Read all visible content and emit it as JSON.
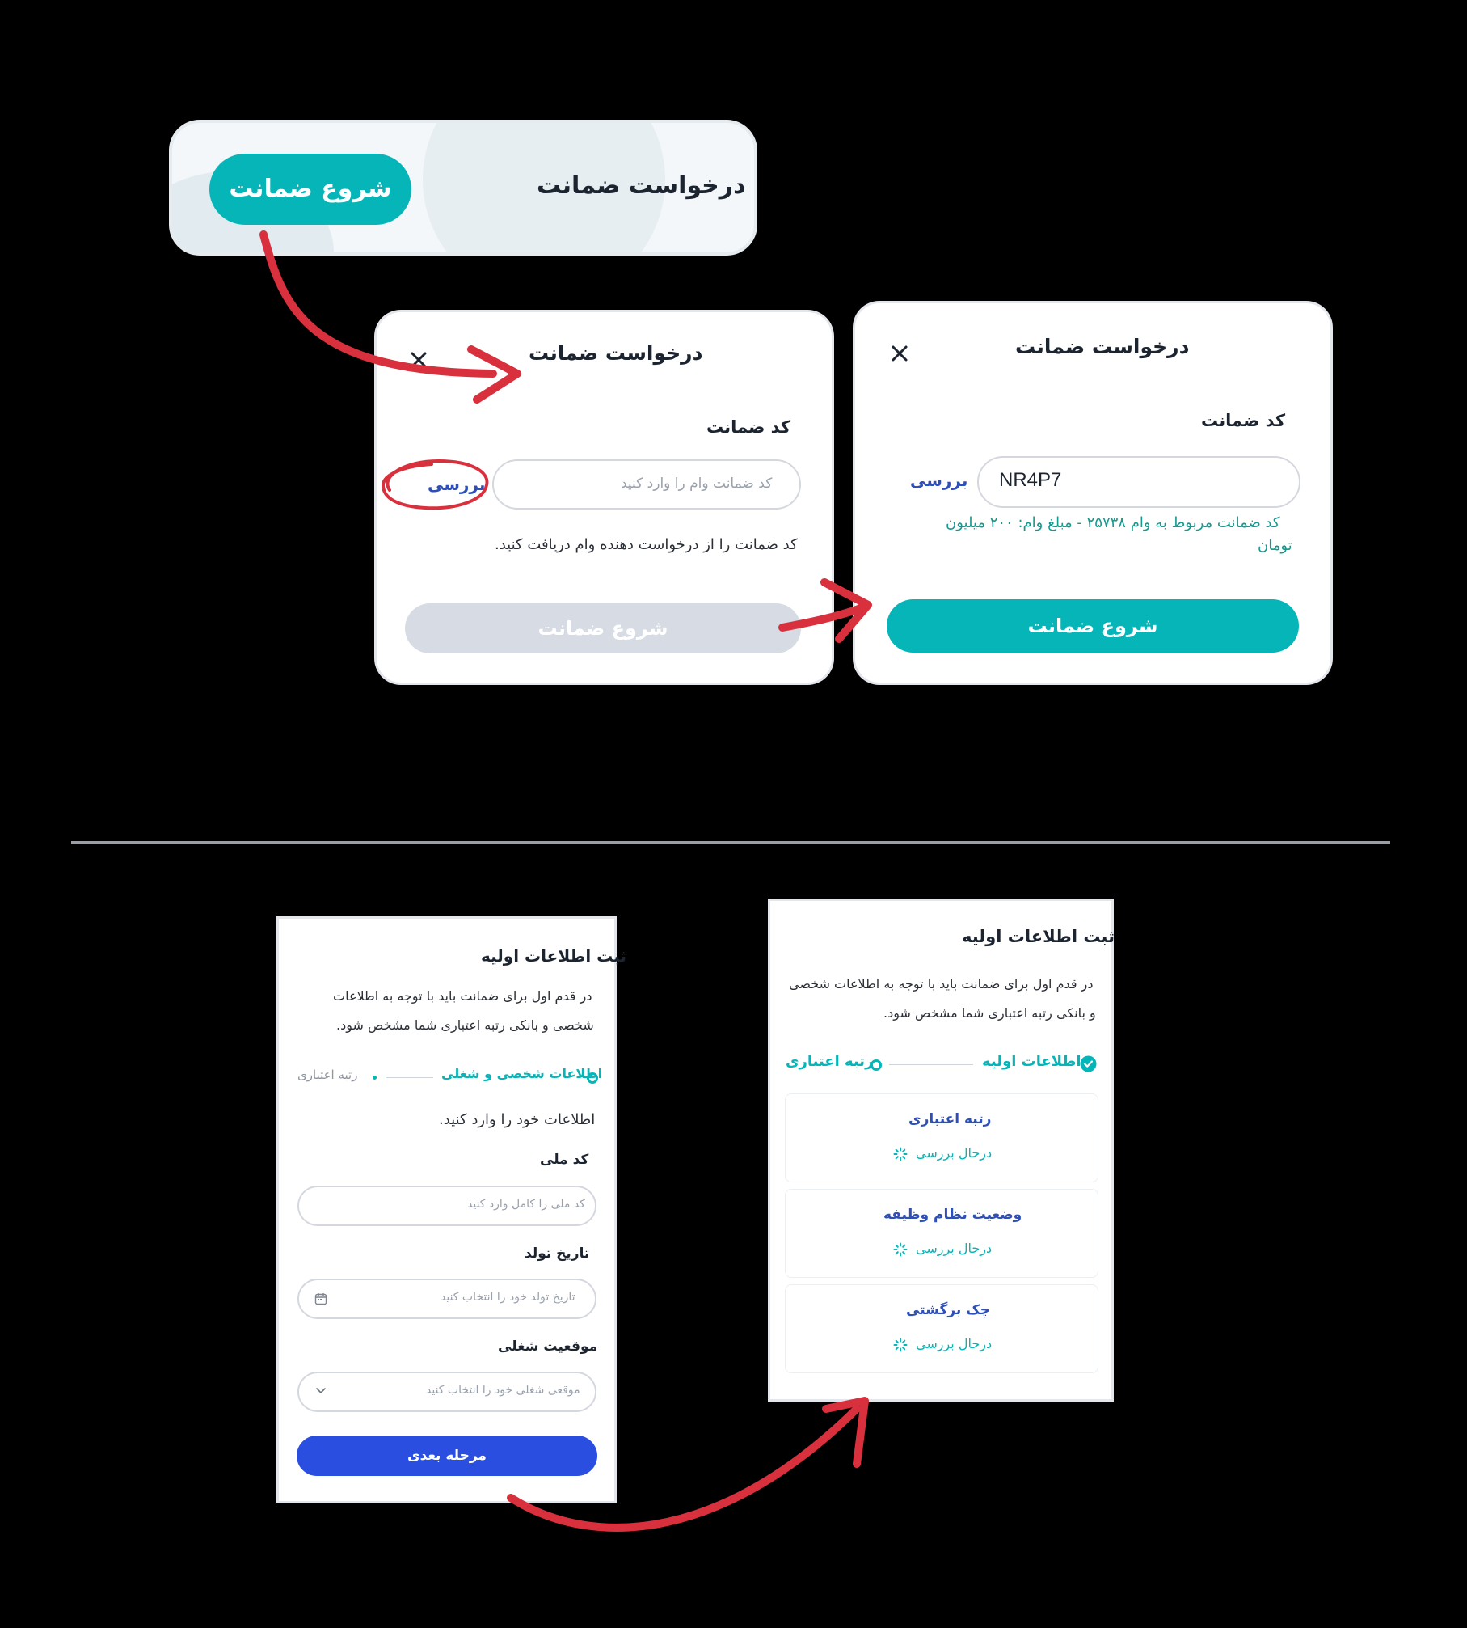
{
  "colors": {
    "teal": "#06b5b8",
    "blue": "#2a4ee0",
    "annotation_red": "#d9303e",
    "disabled": "#d7dce4",
    "check_link": "#2e4fb8",
    "success": "#129a8e"
  },
  "banner": {
    "title": "درخواست ضمانت",
    "start_button": "شروع ضمانت"
  },
  "modal_empty": {
    "title": "درخواست ضمانت",
    "close_icon": "close-icon",
    "code_label": "کد ضمانت",
    "code_placeholder": "کد ضمانت وام را وارد کنید",
    "check_link": "بررسی",
    "helper": "کد ضمانت را از درخواست دهنده وام دریافت کنید.",
    "start_button": "شروع ضمانت"
  },
  "modal_filled": {
    "title": "درخواست ضمانت",
    "close_icon": "close-icon",
    "code_label": "کد ضمانت",
    "code_value": "NR4P7",
    "check_link": "بررسی",
    "result_line1": "کد ضمانت مربوط به وام ۲۵۷۳۸ - مبلغ وام: ۲۰۰ میلیون",
    "result_line2": "تومان",
    "start_button": "شروع ضمانت"
  },
  "form": {
    "title": "ثبت اطلاعات اولیه",
    "desc_line1": "در قدم اول برای ضمانت باید با توجه به اطلاعات",
    "desc_line2": "شخصی و بانکی رتبه اعتباری شما مشخص شود.",
    "step_active": "اطلاعات شخصی و شغلی",
    "step_next": "رتبه اعتباری",
    "instruction": "اطلاعات خود را وارد کنید.",
    "national_code_label": "کد ملی",
    "national_code_placeholder": "کد ملی را کامل وارد کنید",
    "birthdate_label": "تاریخ تولد",
    "birthdate_placeholder": "تاریخ تولد خود را انتخاب کنید",
    "job_label": "موقعیت شغلی",
    "job_placeholder": "موقعی شغلی خود را انتخاب کنید",
    "next_button": "مرحله بعدی"
  },
  "status": {
    "title": "ثبت اطلاعات اولیه",
    "desc_line1": "در قدم اول برای ضمانت باید با توجه به اطلاعات شخصی",
    "desc_line2": "و بانکی رتبه اعتباری شما مشخص شود.",
    "step_done": "اطلاعات اولیه",
    "step_current": "رتبه اعتباری",
    "items": [
      {
        "title": "رتبه اعتباری",
        "state": "درحال بررسی"
      },
      {
        "title": "وضعیت نظام وظیفه",
        "state": "درحال بررسی"
      },
      {
        "title": "چک برگشتی",
        "state": "درحال بررسی"
      }
    ]
  }
}
